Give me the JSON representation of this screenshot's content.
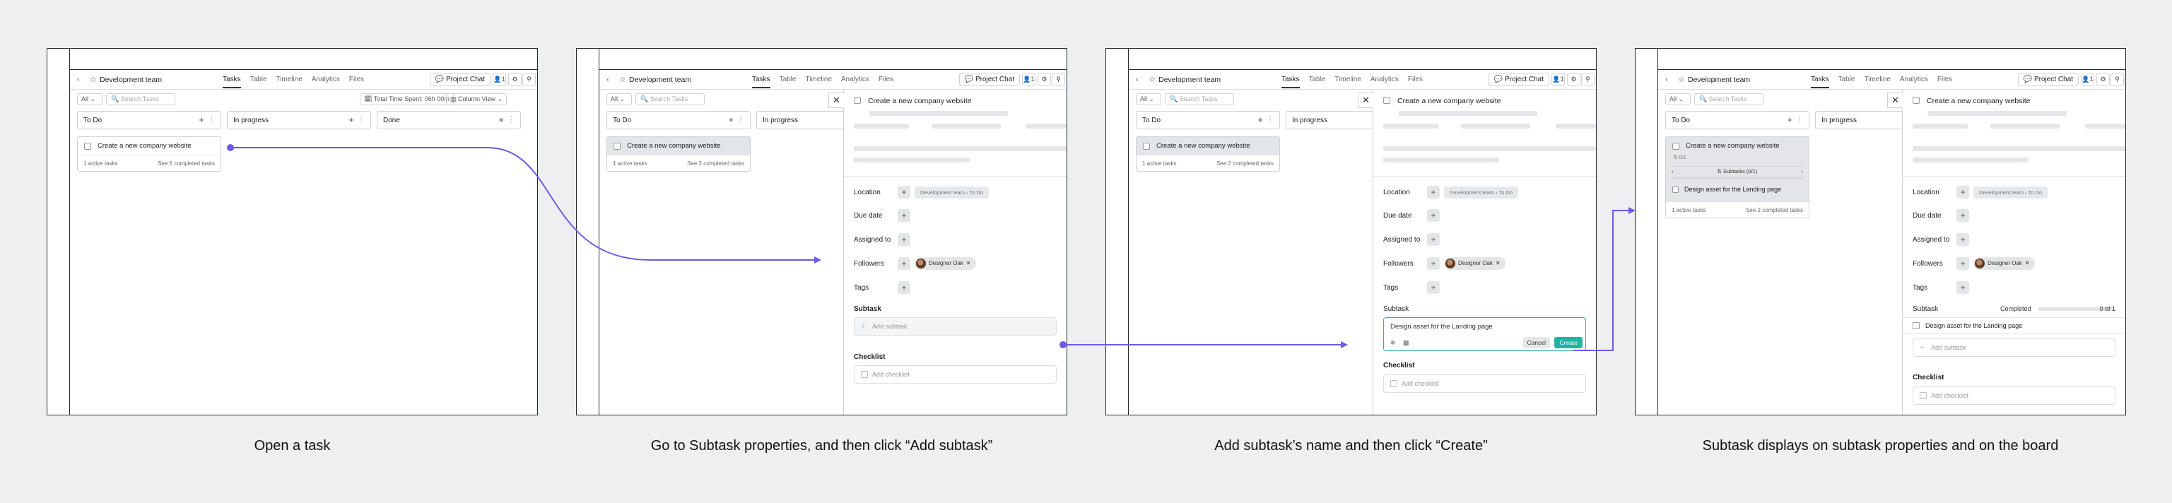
{
  "app": {
    "team_title": "Development team",
    "tabs": [
      "Tasks",
      "Table",
      "Timeline",
      "Analytics",
      "Files"
    ],
    "project_chat": "Project Chat",
    "members": "1",
    "filter_all": "All",
    "search_placeholder": "Search Tasks",
    "total_time": "Total Time Spent: 06h 00m",
    "view_mode": "Column View"
  },
  "board": {
    "columns": [
      "To Do",
      "In progress",
      "Done"
    ],
    "task": "Create a new company website",
    "active_tasks": "1 active tasks",
    "completed_link": "See 2 completed tasks",
    "subtask_count": "0/1",
    "subtasks_label": "Subtasks (0/1)",
    "subtask_name": "Design asset for the Landing page"
  },
  "detail": {
    "title": "Create a new company website",
    "labels": {
      "location": "Location",
      "due_date": "Due date",
      "assigned_to": "Assigned to",
      "followers": "Followers",
      "tags": "Tags",
      "subtask": "Subtask",
      "checklist": "Checklist"
    },
    "location_path": "Development team  ›  To Do",
    "follower": "Designer Oak",
    "add_subtask": "Add subtask",
    "add_checklist": "Add checklist",
    "new_subtask_value": "Design asset for the Landing page",
    "cancel": "Cancel",
    "create": "Create",
    "completed": "Completed",
    "progress_count": "0 of 1",
    "progress_fraction": 0
  },
  "captions": [
    "Open a task",
    "Go to Subtask properties, and then click “Add subtask”",
    "Add subtask’s name and then click “Create”",
    "Subtask displays on subtask properties and on the board"
  ],
  "colors": {
    "arrow": "#6b5be6",
    "create_button": "#23b3a2",
    "background": "#eeeff1"
  }
}
